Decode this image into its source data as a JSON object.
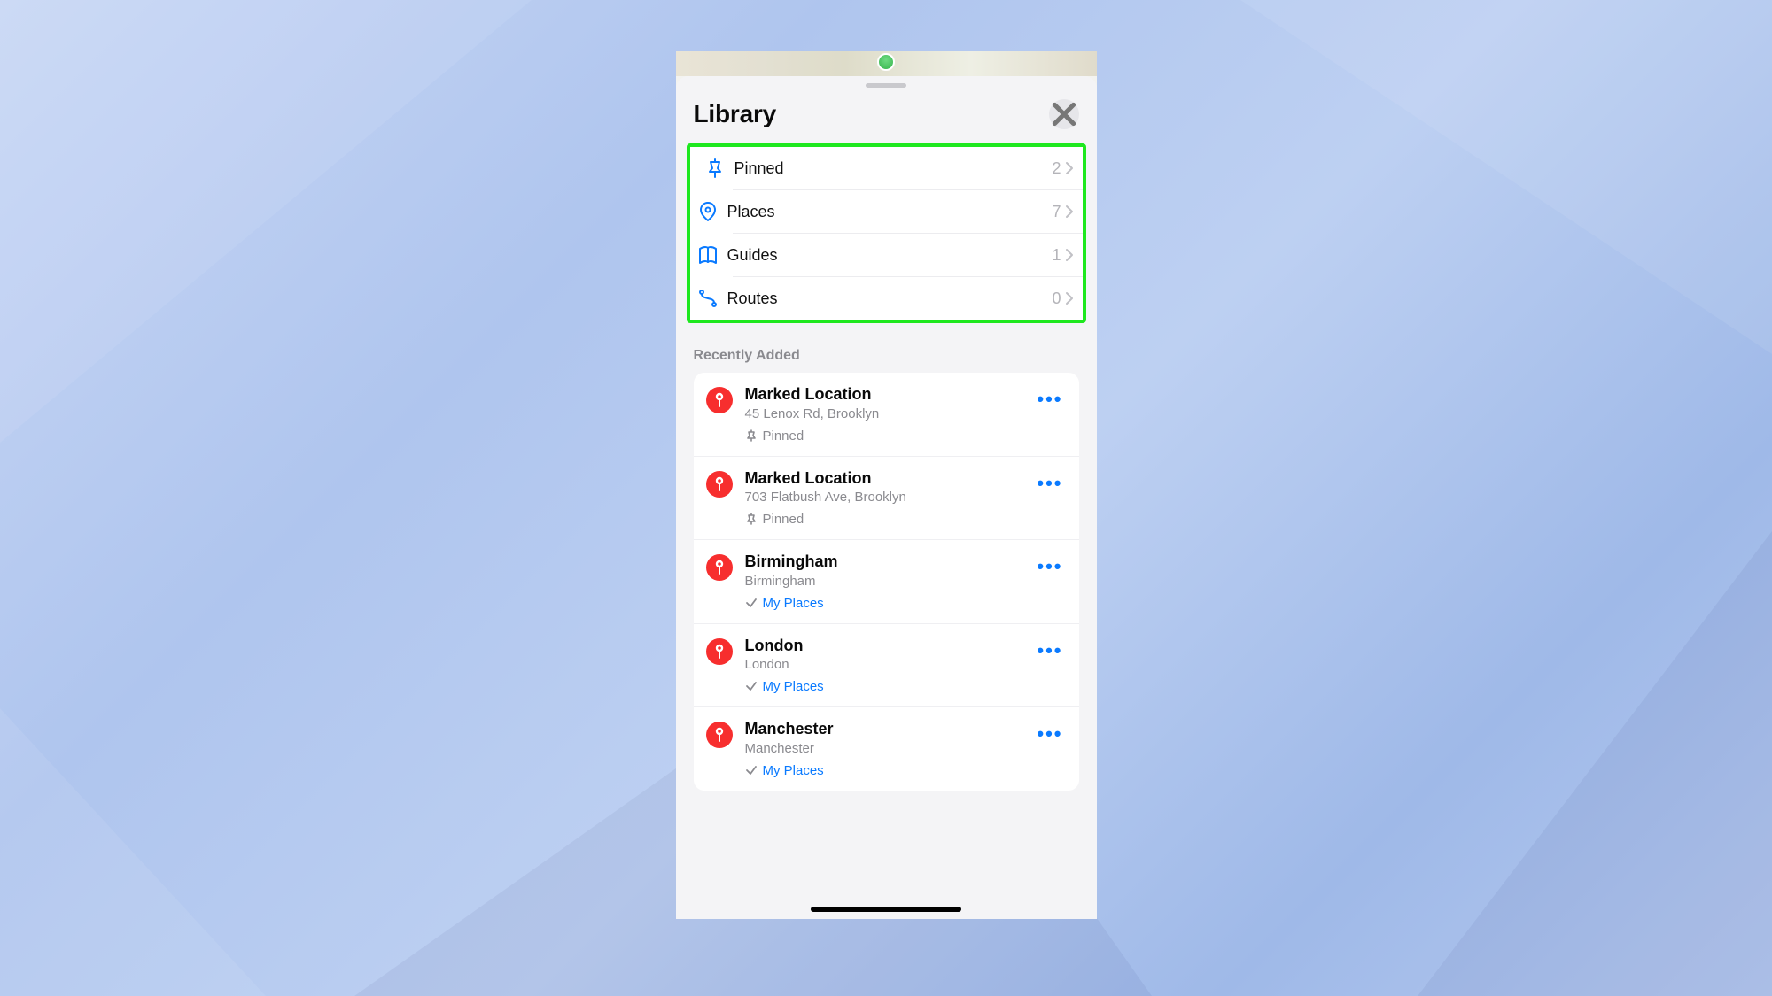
{
  "colors": {
    "accent": "#0a7aff",
    "pin": "#f72e2e",
    "highlight_border": "#1ee81e"
  },
  "header": {
    "title": "Library"
  },
  "categories": [
    {
      "icon": "pin-icon",
      "label": "Pinned",
      "count": "2"
    },
    {
      "icon": "place-icon",
      "label": "Places",
      "count": "7"
    },
    {
      "icon": "book-icon",
      "label": "Guides",
      "count": "1"
    },
    {
      "icon": "route-icon",
      "label": "Routes",
      "count": "0"
    }
  ],
  "section_title": "Recently Added",
  "places": [
    {
      "title": "Marked Location",
      "subtitle": "45 Lenox Rd, Brooklyn",
      "tag_type": "pinned",
      "tag_label": "Pinned"
    },
    {
      "title": "Marked Location",
      "subtitle": "703 Flatbush Ave, Brooklyn",
      "tag_type": "pinned",
      "tag_label": "Pinned"
    },
    {
      "title": "Birmingham",
      "subtitle": "Birmingham",
      "tag_type": "guide",
      "tag_label": "My Places"
    },
    {
      "title": "London",
      "subtitle": "London",
      "tag_type": "guide",
      "tag_label": "My Places"
    },
    {
      "title": "Manchester",
      "subtitle": "Manchester",
      "tag_type": "guide",
      "tag_label": "My Places"
    }
  ]
}
